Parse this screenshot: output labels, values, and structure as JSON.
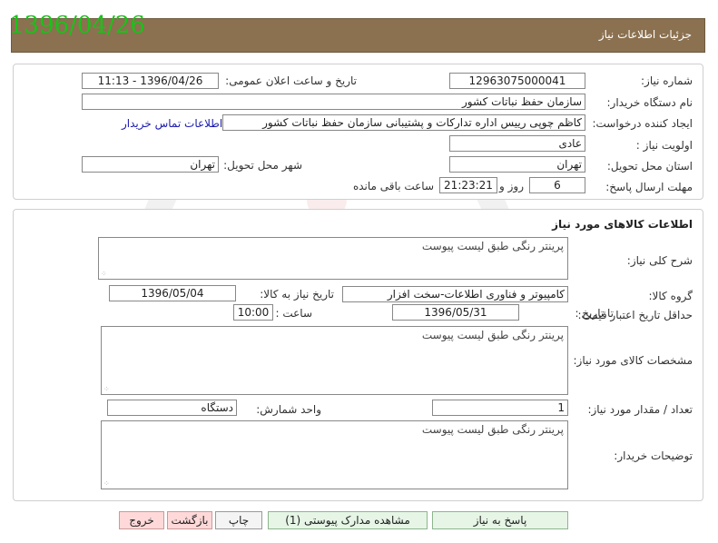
{
  "header": {
    "title": "جزئیات اطلاعات نیاز",
    "date_stamp": "1396/04/26"
  },
  "request": {
    "need_number_label": "شماره نیاز:",
    "need_number": "12963075000041",
    "announce_label": "تاریخ و ساعت اعلان عمومی:",
    "announce_value": "1396/04/26 - 11:13",
    "buyer_org_label": "نام دستگاه خریدار:",
    "buyer_org": "سازمان حفظ نباتات کشور",
    "creator_label": "ایجاد کننده درخواست:",
    "creator": "کاظم چوپی رییس اداره تدارکات و پشتیبانی سازمان حفظ نباتات کشور",
    "contact_link": "اطلاعات تماس خریدار",
    "priority_label": "اولویت نیاز :",
    "priority": "عادی",
    "province_label": "استان محل تحویل:",
    "province": "تهران",
    "city_label": "شهر محل تحویل:",
    "city": "تهران",
    "deadline_label": "مهلت ارسال پاسخ:",
    "days_value": "6",
    "days_suffix": "روز و",
    "time_value": "21:23:21",
    "time_suffix": "ساعت باقی مانده"
  },
  "goods": {
    "section_title": "اطلاعات کالاهای مورد نیاز",
    "summary_label": "شرح کلی نیاز:",
    "summary": "پرینتر رنگی طبق لیست پیوست",
    "group_label": "گروه کالا:",
    "group": "کامپیوتر و فناوری اطلاعات-سخت افزار",
    "need_date_label": "تاریخ نیاز به کالا:",
    "need_date": "1396/05/04",
    "validity_label": "حداقل تاریخ اعتبار قیمت:",
    "until_label": "تا تاریخ :",
    "validity_date": "1396/05/31",
    "hour_label": "ساعت :",
    "validity_time": "10:00",
    "specs_label": "مشخصات کالای مورد نیاز:",
    "specs": "پرینتر رنگی طبق لیست پیوست",
    "qty_label": "تعداد / مقدار مورد نیاز:",
    "qty": "1",
    "unit_label": "واحد شمارش:",
    "unit": "دستگاه",
    "buyer_notes_label": "توضیحات خریدار:",
    "buyer_notes": "پرینتر رنگی طبق لیست پیوست"
  },
  "buttons": {
    "reply": "پاسخ به نیاز",
    "attachments": "مشاهده مدارک پیوستی (1)",
    "print": "چاپ",
    "back": "بازگشت",
    "exit": "خروج"
  },
  "colors": {
    "header_bg": "#8b7150",
    "header_text": "#ffffff",
    "date_stamp": "#19c219",
    "link": "#1a1ab0"
  }
}
